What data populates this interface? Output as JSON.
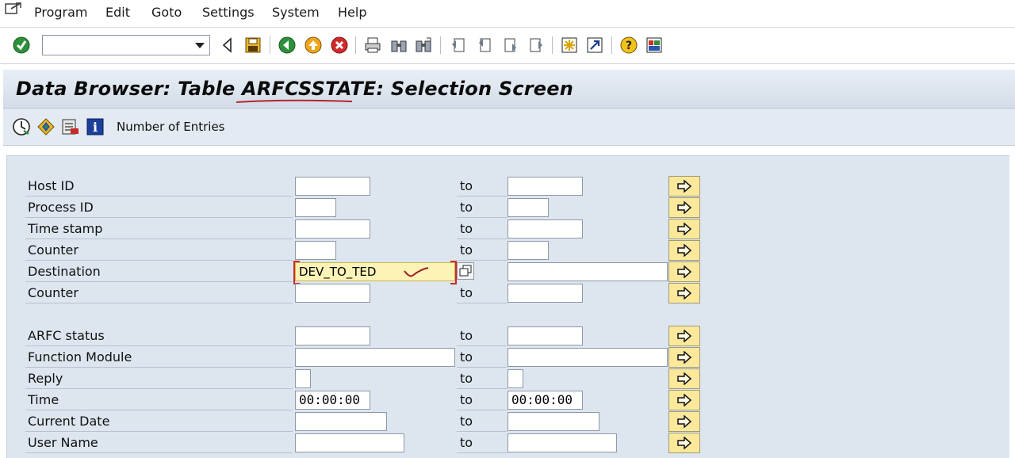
{
  "menubar": {
    "items": [
      "Program",
      "Edit",
      "Goto",
      "Settings",
      "System",
      "Help"
    ]
  },
  "toolbar": {
    "command_field_value": "",
    "icons": [
      "enter-check-icon",
      "back-triangle-icon",
      "save-icon",
      "back-green-icon",
      "exit-up-icon",
      "cancel-red-icon",
      "print-icon",
      "find-icon",
      "find-next-icon",
      "first-page-icon",
      "previous-page-icon",
      "next-page-icon",
      "last-page-icon",
      "create-session-icon",
      "generate-shortcut-icon",
      "help-icon",
      "customize-layout-icon"
    ]
  },
  "title": {
    "text": "Data Browser: Table ARFCSSTATE: Selection Screen",
    "underline_color": "#b3262b"
  },
  "appbar": {
    "number_of_entries_label": "Number of Entries"
  },
  "form": {
    "to_label": "to",
    "rows": [
      {
        "label": "Host ID",
        "from": "",
        "to": ""
      },
      {
        "label": "Process ID",
        "from": "",
        "to": ""
      },
      {
        "label": "Time stamp",
        "from": "",
        "to": ""
      },
      {
        "label": "Counter",
        "from": "",
        "to": ""
      },
      {
        "label": "Destination",
        "from": "DEV_TO_TED",
        "to": ""
      },
      {
        "label": "Counter",
        "from": "",
        "to": ""
      },
      {
        "label": "ARFC status",
        "from": "",
        "to": ""
      },
      {
        "label": "Function Module",
        "from": "",
        "to": ""
      },
      {
        "label": "Reply",
        "from": "",
        "to": ""
      },
      {
        "label": "Time",
        "from": "00:00:00",
        "to": "00:00:00"
      },
      {
        "label": "Current Date",
        "from": "",
        "to": ""
      },
      {
        "label": "User Name",
        "from": "",
        "to": ""
      }
    ]
  },
  "colors": {
    "highlight_field": "#fdf3b6",
    "multiple_selection_button": "#fbe89a",
    "annotation_red": "#cc2a2a"
  }
}
